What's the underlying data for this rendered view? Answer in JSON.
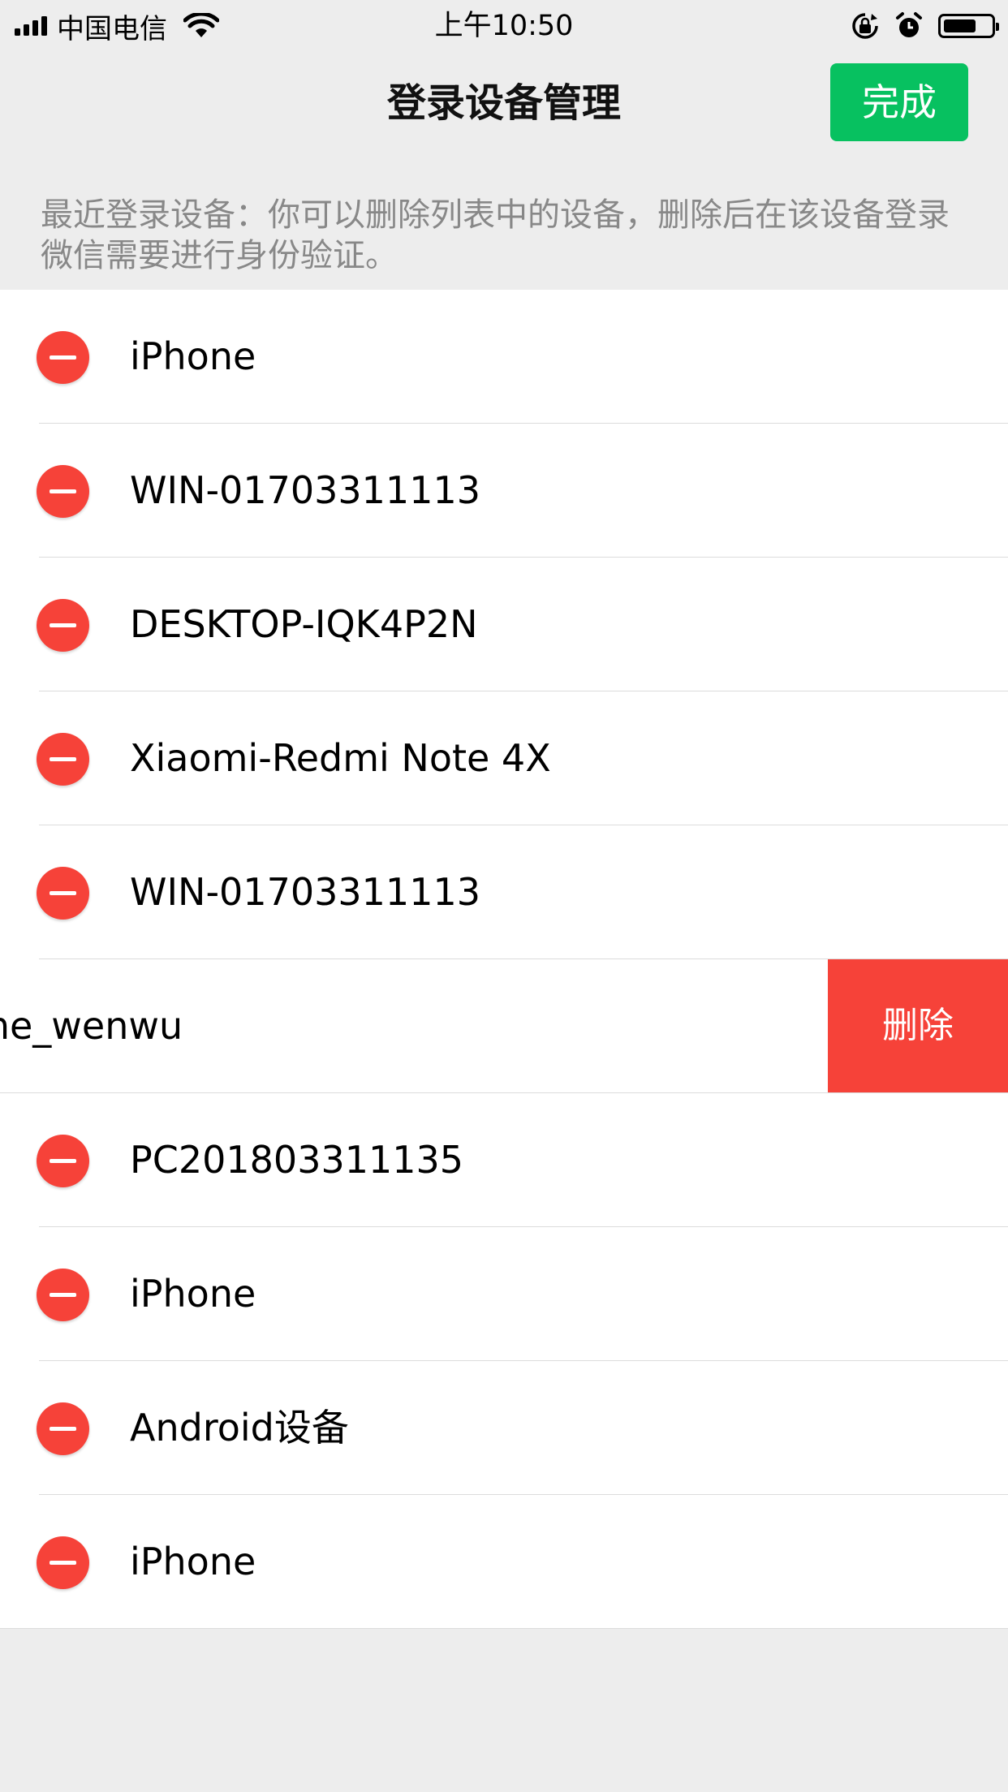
{
  "status_bar": {
    "carrier": "中国电信",
    "time": "上午10:50",
    "icons": [
      "signal-icon",
      "wifi-icon",
      "orientation-lock-icon",
      "alarm-icon",
      "battery-icon"
    ],
    "battery_level": 0.7
  },
  "nav": {
    "title": "登录设备管理",
    "done_label": "完成",
    "done_color": "#07c160"
  },
  "hint": "最近登录设备：你可以删除列表中的设备，删除后在该设备登录微信需要进行身份验证。",
  "delete_color": "#f64239",
  "devices": [
    {
      "name": "iPhone"
    },
    {
      "name": "WIN-01703311113"
    },
    {
      "name": "DESKTOP-IQK4P2N"
    },
    {
      "name": "Xiaomi-Redmi Note 4X"
    },
    {
      "name": "WIN-01703311113"
    },
    {
      "name": "iPhone_wenwu",
      "swiped": true,
      "delete_label": "删除"
    },
    {
      "name": "PC201803311135"
    },
    {
      "name": "iPhone"
    },
    {
      "name": "Android设备"
    },
    {
      "name": "iPhone"
    }
  ]
}
